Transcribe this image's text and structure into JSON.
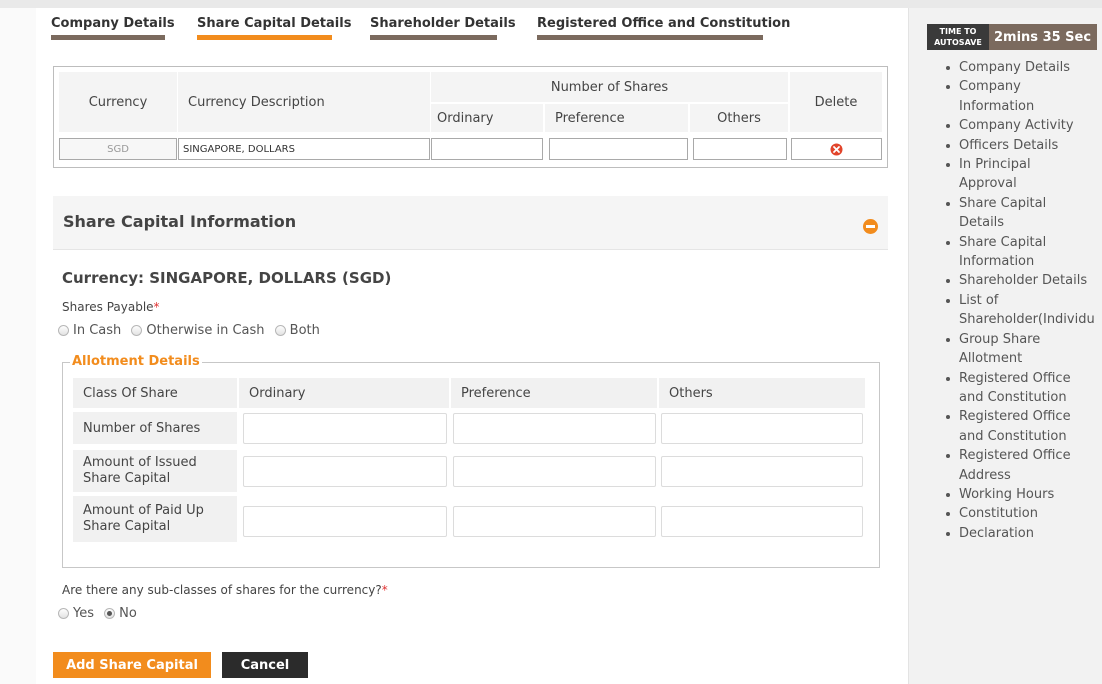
{
  "tabs": [
    {
      "label": "Company Details"
    },
    {
      "label": "Share Capital Details"
    },
    {
      "label": "Shareholder Details"
    },
    {
      "label": "Registered Office and Constitution"
    }
  ],
  "currency_table": {
    "headers": {
      "currency": "Currency",
      "currency_description": "Currency Description",
      "number_of_shares": "Number of Shares",
      "ordinary": "Ordinary",
      "preference": "Preference",
      "others": "Others",
      "delete": "Delete"
    },
    "row": {
      "currency": "SGD",
      "currency_description": "SINGAPORE, DOLLARS",
      "ordinary": "",
      "preference": "",
      "others": ""
    }
  },
  "share_capital": {
    "title": "Share Capital Information",
    "currency_line": "Currency: SINGAPORE, DOLLARS (SGD)",
    "shares_payable_label": "Shares Payable",
    "required_mark": "*",
    "payable_options": [
      "In Cash",
      "Otherwise in Cash",
      "Both"
    ],
    "allotment": {
      "legend": "Allotment Details",
      "columns": [
        "Class Of Share",
        "Ordinary",
        "Preference",
        "Others"
      ],
      "rows": [
        "Number of Shares",
        "Amount of Issued Share Capital",
        "Amount of Paid Up Share Capital"
      ]
    },
    "subclass_question": "Are there any sub-classes of shares for the currency?",
    "subclass_options": [
      "Yes",
      "No"
    ],
    "subclass_selected": "No"
  },
  "buttons": {
    "add": "Add Share Capital",
    "cancel": "Cancel"
  },
  "timer": {
    "label_line1": "TIME TO",
    "label_line2": "AUTOSAVE",
    "value": "2mins 35 Sec"
  },
  "nav_items": [
    "Company Details",
    "Company",
    "Information",
    "Company Activity",
    "Officers Details",
    "In Principal",
    "Approval",
    "Share Capital",
    "Details",
    "Share Capital",
    "Information",
    "Shareholder Details",
    "List of",
    "Shareholder(Individu",
    "Group Share",
    "Allotment",
    "Registered Office",
    "and Constitution",
    "Registered Office",
    "and Constitution",
    "Registered Office",
    "Address",
    "Working Hours",
    "Constitution",
    "Declaration"
  ],
  "colors": {
    "accent": "#f28c1d",
    "tab_bar": "#7b6a5e",
    "dark_button": "#2b2b2b",
    "delete_icon": "#e2452b"
  }
}
